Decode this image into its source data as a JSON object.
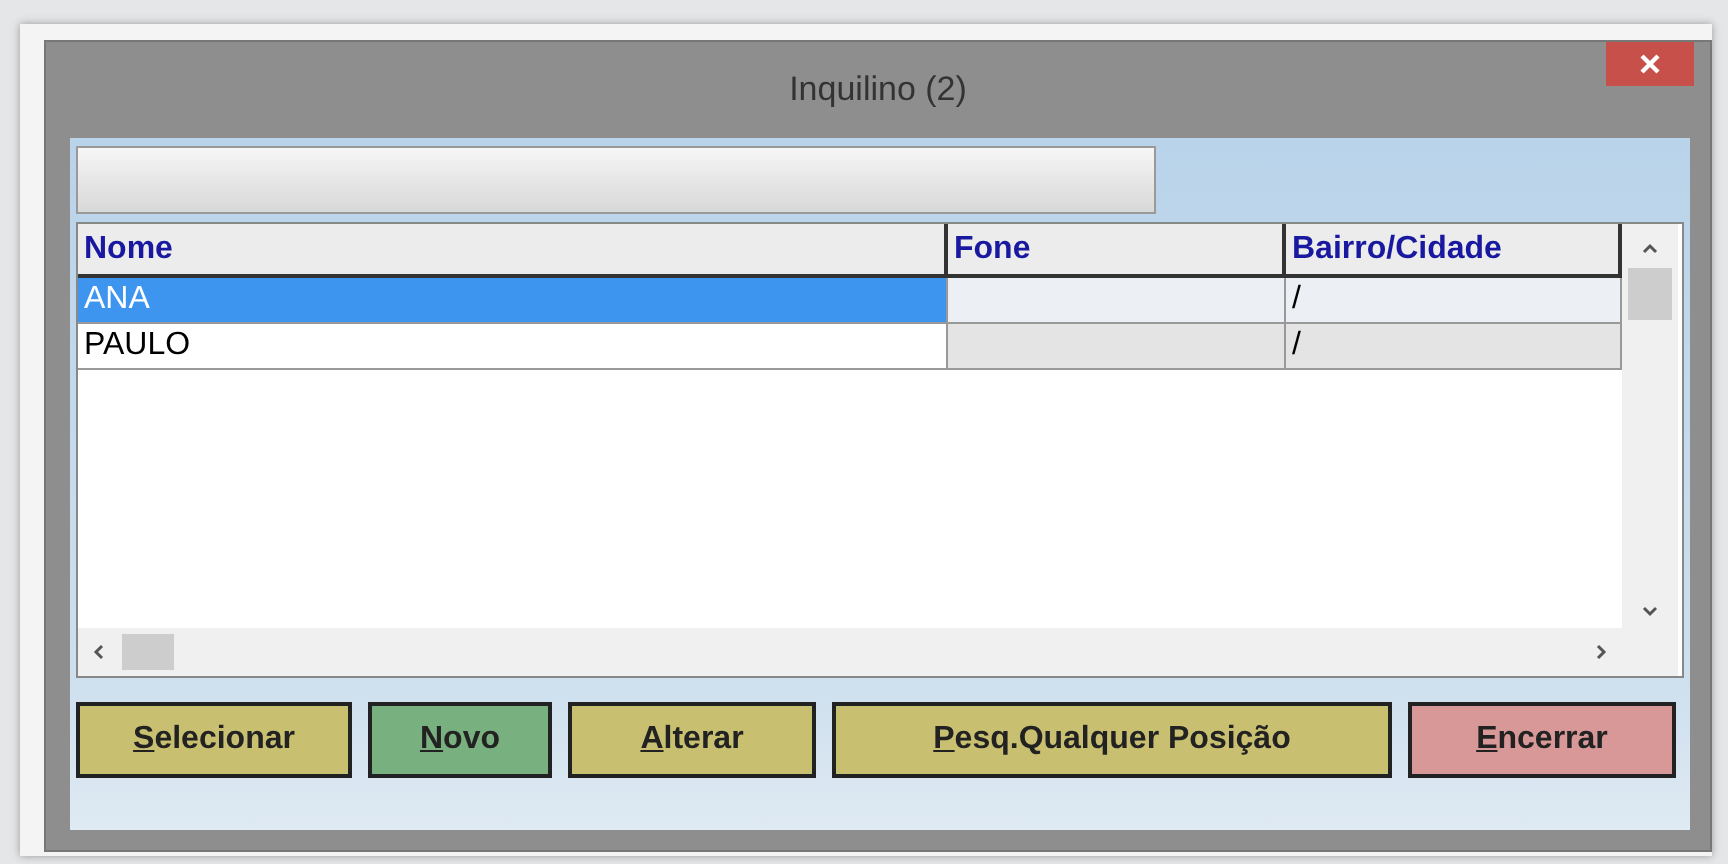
{
  "window": {
    "title": "Inquilino (2)"
  },
  "table": {
    "columns": [
      "Nome",
      "Fone",
      "Bairro/Cidade"
    ],
    "rows": [
      {
        "cells": [
          "ANA",
          "",
          "/"
        ],
        "selected": true
      },
      {
        "cells": [
          "PAULO",
          "",
          "/"
        ],
        "selected": false
      }
    ]
  },
  "buttons": [
    {
      "label": "Selecionar",
      "color": "#c8c070"
    },
    {
      "label": "Novo",
      "color": "#78b080"
    },
    {
      "label": "Alterar",
      "color": "#c8c070"
    },
    {
      "label": "Pesq.Qualquer Posição",
      "color": "#c8c070"
    },
    {
      "label": "Encerrar",
      "color": "#d89898"
    }
  ]
}
